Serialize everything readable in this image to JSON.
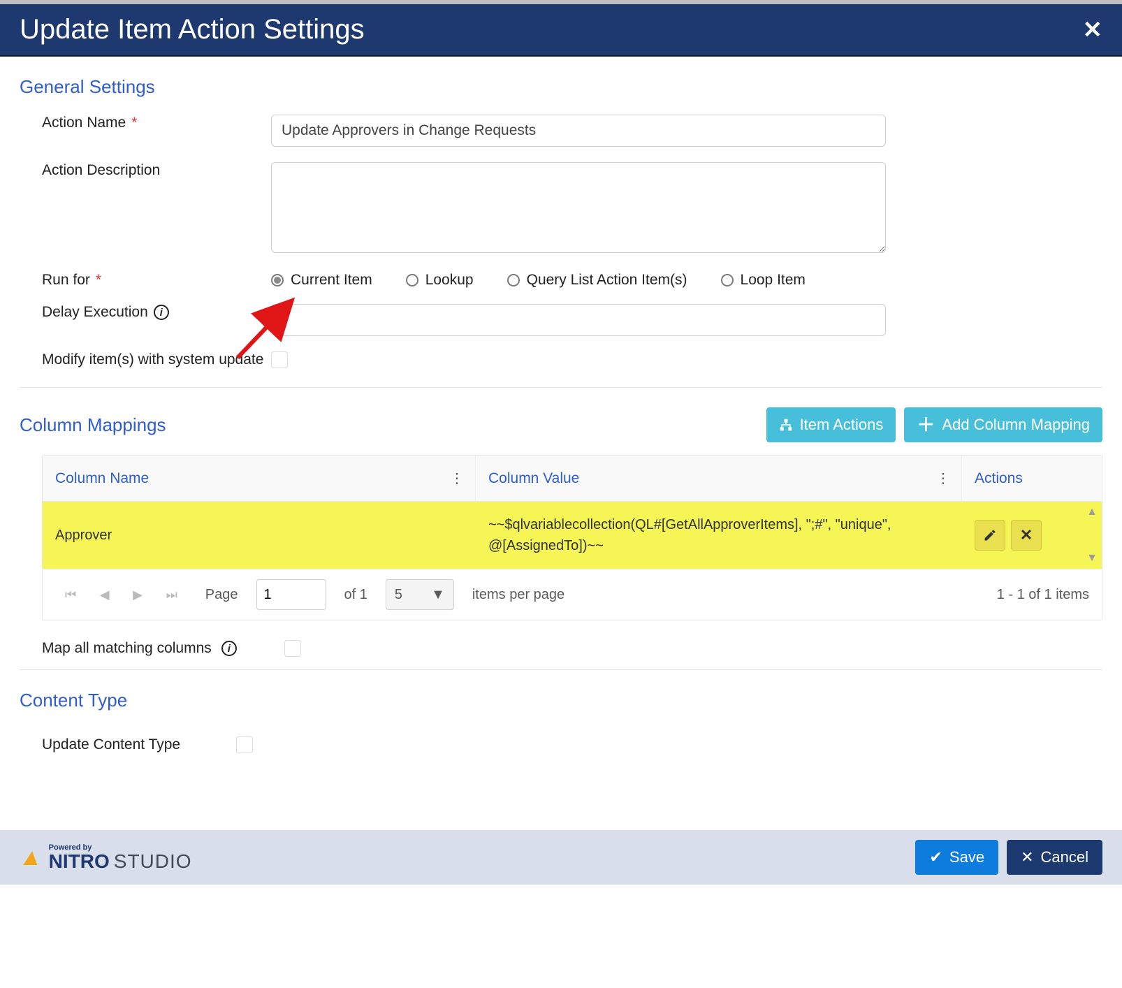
{
  "header": {
    "title": "Update Item Action Settings"
  },
  "sections": {
    "general": {
      "title": "General Settings"
    },
    "columnMappings": {
      "title": "Column Mappings"
    },
    "contentType": {
      "title": "Content Type"
    }
  },
  "form": {
    "actionName": {
      "label": "Action Name",
      "value": "Update Approvers in Change Requests"
    },
    "actionDescription": {
      "label": "Action Description",
      "value": ""
    },
    "runFor": {
      "label": "Run for",
      "selected": "current",
      "options": {
        "current": "Current Item",
        "lookup": "Lookup",
        "query": "Query List Action Item(s)",
        "loop": "Loop Item"
      }
    },
    "delayExecution": {
      "label": "Delay Execution",
      "value": ""
    },
    "modifySystem": {
      "label": "Modify item(s) with system update",
      "checked": false
    }
  },
  "cmButtons": {
    "itemActions": "Item Actions",
    "addMapping": "Add Column Mapping"
  },
  "grid": {
    "headers": {
      "col1": "Column Name",
      "col2": "Column Value",
      "col3": "Actions"
    },
    "rows": [
      {
        "columnName": "Approver",
        "columnValue": "~~$qlvariablecollection(QL#[GetAllApproverItems], \";#\", \"unique\", @[AssignedTo])~~",
        "highlighted": true
      }
    ]
  },
  "pager": {
    "pageLabel": "Page",
    "page": "1",
    "ofLabel": "of 1",
    "perPage": "5",
    "perPageLabel": "items per page",
    "summary": "1 - 1 of 1 items"
  },
  "mapAll": {
    "label": "Map all matching columns",
    "checked": false
  },
  "contentType": {
    "label": "Update Content Type",
    "checked": false
  },
  "footer": {
    "poweredBy": "Powered by",
    "brand": "NITRO",
    "brand2": "STUDIO",
    "save": "Save",
    "cancel": "Cancel"
  }
}
